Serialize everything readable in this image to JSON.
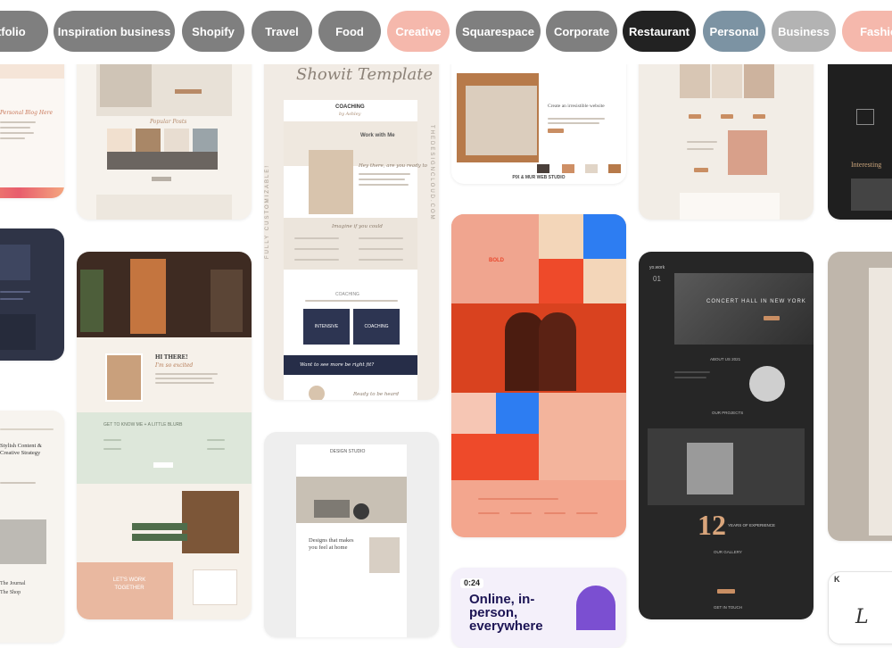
{
  "categories": [
    {
      "label": "Portfolio",
      "color": "#7f7f7f"
    },
    {
      "label": "Inspiration business",
      "color": "#7f7f7f"
    },
    {
      "label": "Shopify",
      "color": "#7f7f7f"
    },
    {
      "label": "Travel",
      "color": "#7f7f7f"
    },
    {
      "label": "Food",
      "color": "#7f7f7f"
    },
    {
      "label": "Creative",
      "color": "#f5b8ac"
    },
    {
      "label": "Squarespace",
      "color": "#7f7f7f"
    },
    {
      "label": "Corporate",
      "color": "#7f7f7f"
    },
    {
      "label": "Restaurant",
      "color": "#222222"
    },
    {
      "label": "Personal",
      "color": "#7c93a3"
    },
    {
      "label": "Business",
      "color": "#b3b3b3"
    },
    {
      "label": "Fashion",
      "color": "#f5b8ac"
    }
  ],
  "cards": {
    "coaching": {
      "script_title": "Showit Template",
      "logo": "COACHING",
      "logo_sub": "by Ashley",
      "hero_script": "Work with Me",
      "side_left": "FULLY CUSTOMIZABLE!",
      "side_right": "THEDESIGNCLOUD.COM",
      "hey_line": "Hey there, are you ready to",
      "section_script": "Imagine if you could",
      "coaching_label": "COACHING",
      "box_left": "INTENSIVE",
      "box_right": "COACHING",
      "band_script": "Want to see more be right fit?",
      "footer_script": "Ready to be heard"
    },
    "studio": {
      "footer": "PIX & MUR WEB STUDIO",
      "headline": "Create an irresistible website"
    },
    "bold": {
      "badge": "BOLD"
    },
    "concert": {
      "logo": "yo.work",
      "number": "01",
      "headline": "CONCERT HALL IN NEW YORK",
      "about": "ABOUT US 2021",
      "projects": "OUR PROJECTS",
      "big_number": "12",
      "big_sub": "YEARS OF EXPERIENCE",
      "gallery": "OUR GALLERY",
      "contact": "GET IN TOUCH"
    },
    "hithere": {
      "greeting": "HI THERE!",
      "sub": "I'm so excited",
      "band": "GET TO KNOW ME + A LITTLE BLURB",
      "cta": "LET'S WORK TOGETHER"
    },
    "interior": {
      "logo": "DESIGN STUDIO",
      "headline": "Designs that makes you feel at home"
    },
    "online": {
      "timer": "0:24",
      "headline": "Online, in-person, everywhere"
    },
    "journal": {
      "headline": "Stylish Content & Creative Strategy",
      "nav1": "The Journal",
      "nav2": "The Shop"
    },
    "dark_right": {
      "heading": "Interesting"
    },
    "left_top": {
      "blurb": "Personal Blog Here"
    }
  }
}
